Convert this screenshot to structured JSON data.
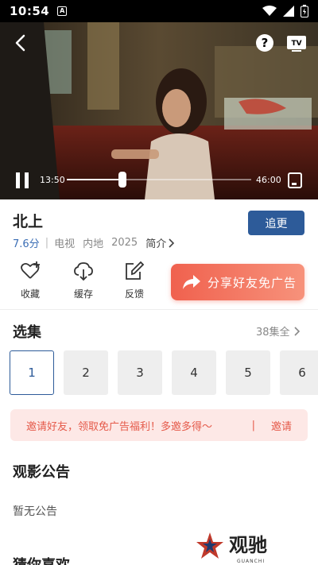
{
  "status_bar": {
    "time": "10:54",
    "notification_letter": "A"
  },
  "player": {
    "current_time": "13:50",
    "total_time": "46:00",
    "progress": 0.3
  },
  "show": {
    "title": "北上",
    "follow_label": "追更",
    "score": "7.6分",
    "meta": [
      "电视",
      "内地",
      "2025"
    ],
    "intro_label": "简介"
  },
  "actions": [
    {
      "label": "收藏",
      "icon": "heart-plus-icon"
    },
    {
      "label": "缓存",
      "icon": "cloud-download-icon"
    },
    {
      "label": "反馈",
      "icon": "edit-icon"
    }
  ],
  "share_banner": {
    "label": "分享好友免广告",
    "icon": "share-arrow-icon"
  },
  "episodes": {
    "title": "选集",
    "count_label": "38集全",
    "items": [
      "1",
      "2",
      "3",
      "4",
      "5",
      "6"
    ],
    "selected": "1"
  },
  "invite": {
    "text": "邀请好友，领取免广告福利！多邀多得～",
    "separator": "|",
    "action": "邀请"
  },
  "notice": {
    "title": "观影公告",
    "body": "暂无公告"
  },
  "recommend": {
    "title": "猜你喜欢"
  },
  "watermark": {
    "brand": "观驰",
    "brand_en": "GUANCHI"
  },
  "colors": {
    "accent": "#2d5b99",
    "share": "#f0614e",
    "invite_bg": "#fde8e6",
    "score": "#3b6eb5"
  }
}
